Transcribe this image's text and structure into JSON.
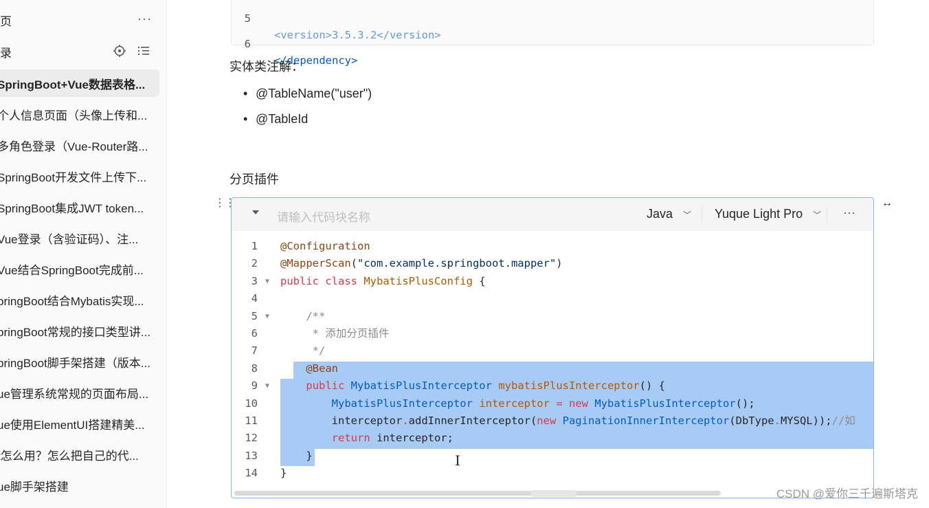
{
  "sidebar": {
    "header1": "页",
    "header2": "录",
    "items": [
      {
        "label": "SpringBoot+Vue数据表格...",
        "active": true
      },
      {
        "label": "个人信息页面（头像上传和..."
      },
      {
        "label": "多角色登录（Vue-Router路..."
      },
      {
        "label": "SpringBoot开发文件上传下..."
      },
      {
        "label": "SpringBoot集成JWT token..."
      },
      {
        "label": "Vue登录（含验证码）、注..."
      },
      {
        "label": "Vue结合SpringBoot完成前..."
      },
      {
        "label": "pringBoot结合Mybatis实现..."
      },
      {
        "label": "pringBoot常规的接口类型讲..."
      },
      {
        "label": "pringBoot脚手架搭建（版本..."
      },
      {
        "label": "ue管理系统常规的页面布局..."
      },
      {
        "label": "ue使用ElementUI搭建精美..."
      },
      {
        "label": "t怎么用？怎么把自己的代..."
      },
      {
        "label": "ue脚手架搭建"
      }
    ]
  },
  "top_code": {
    "line5_num": "5",
    "line5_text": "<version>3.5.3.2</version>",
    "line6_num": "6",
    "line6_text": "</dependency>"
  },
  "content": {
    "entity_heading": "实体类注解：",
    "bullets": [
      "@TableName(\"user\")",
      "@TableId"
    ],
    "plugin_heading": "分页插件"
  },
  "codeblock": {
    "name_placeholder": "请输入代码块名称",
    "language": "Java",
    "theme": "Yuque Light Pro",
    "more": "···"
  },
  "watermark": "CSDN @爱你三千遍斯塔克"
}
